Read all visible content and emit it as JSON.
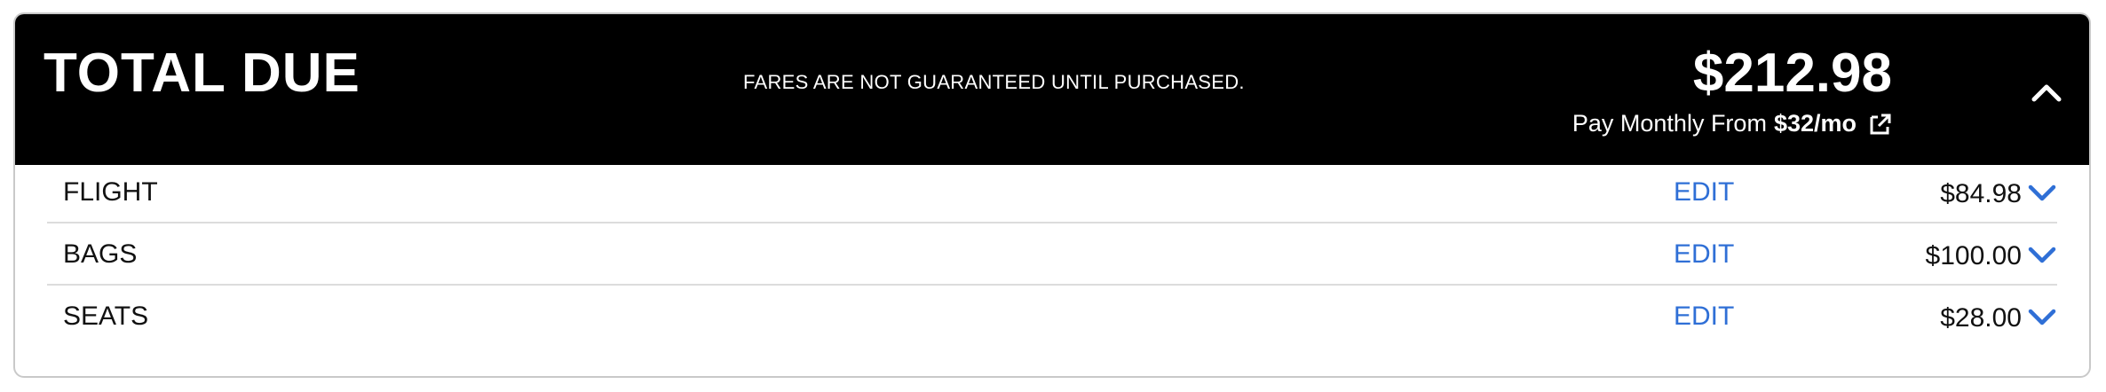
{
  "header": {
    "title": "TOTAL DUE",
    "disclaimer": "FARES ARE NOT GUARANTEED UNTIL PURCHASED.",
    "total": "$212.98",
    "pay_monthly_label": "Pay Monthly From",
    "pay_monthly_amount": "$32/mo",
    "external_link_icon": "external-link-icon",
    "collapse_icon": "chevron-up-icon"
  },
  "items": [
    {
      "label": "FLIGHT",
      "edit": "EDIT",
      "price": "$84.98",
      "expand_icon": "chevron-down-icon"
    },
    {
      "label": "BAGS",
      "edit": "EDIT",
      "price": "$100.00",
      "expand_icon": "chevron-down-icon"
    },
    {
      "label": "SEATS",
      "edit": "EDIT",
      "price": "$28.00",
      "expand_icon": "chevron-down-icon"
    }
  ],
  "colors": {
    "header_bg": "#000000",
    "header_text": "#ffffff",
    "link": "#2f6fd6",
    "divider": "#dcdcdc"
  }
}
